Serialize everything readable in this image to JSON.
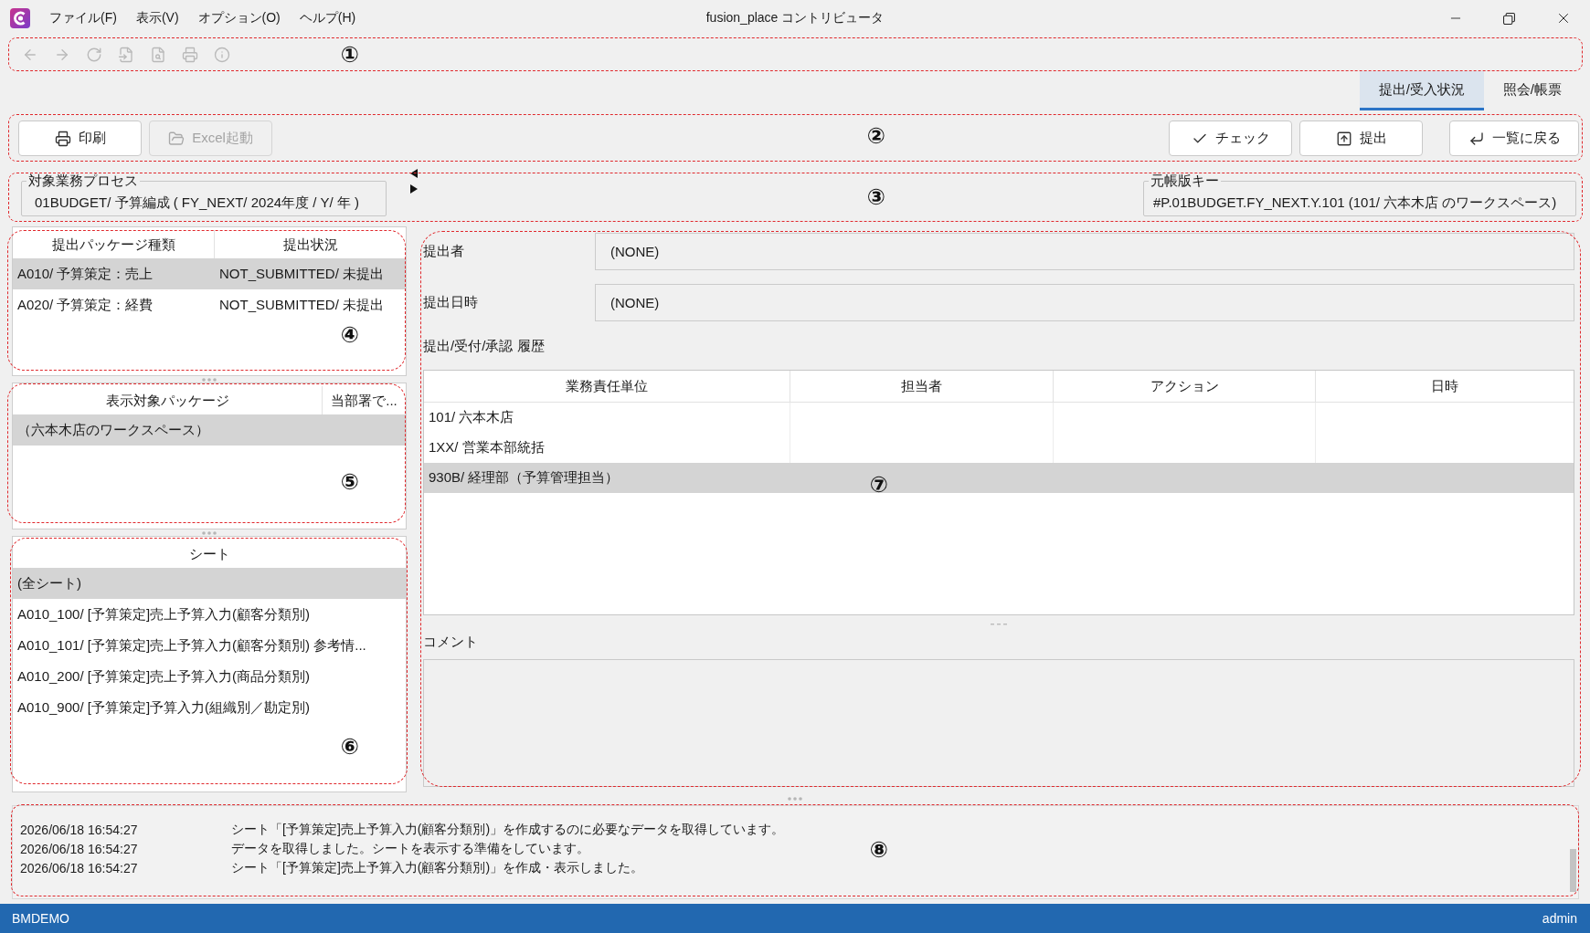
{
  "window": {
    "title": "fusion_place コントリビュータ",
    "menu": [
      "ファイル(F)",
      "表示(V)",
      "オプション(O)",
      "ヘルプ(H)"
    ]
  },
  "toolbar": {
    "callout": "①",
    "buttons": [
      {
        "disabled": true
      },
      {
        "disabled": true
      },
      {
        "disabled": true
      },
      {
        "disabled": true
      },
      {
        "disabled": true
      },
      {
        "disabled": true
      },
      {
        "disabled": true
      }
    ]
  },
  "tabs": [
    {
      "label": "提出/受入状況",
      "selected": true
    },
    {
      "label": "照会/帳票",
      "selected": false
    }
  ],
  "action_bar": {
    "callout": "②",
    "left_buttons": [
      {
        "label": "印刷",
        "disabled": false
      },
      {
        "label": "Excel起動",
        "disabled": true
      }
    ],
    "right_buttons": [
      {
        "label": "チェック",
        "disabled": false
      },
      {
        "label": "提出",
        "disabled": false
      }
    ],
    "back_button": {
      "label": "一覧に戻る",
      "disabled": false
    }
  },
  "context": {
    "callout": "③",
    "process": {
      "legend": "対象業務プロセス",
      "value": "01BUDGET/ 予算編成 ( FY_NEXT/ 2024年度 / Y/ 年 )"
    },
    "ledger_key": {
      "legend": "元帳版キー",
      "value": "#P.01BUDGET.FY_NEXT.Y.101 (101/ 六本木店 のワークスペース)"
    }
  },
  "package_table": {
    "callout": "④",
    "columns": [
      "提出パッケージ種類",
      "提出状況"
    ],
    "rows": [
      {
        "cells": [
          "A010/ 予算策定：売上",
          "NOT_SUBMITTED/ 未提出"
        ],
        "selected": true
      },
      {
        "cells": [
          "A020/ 予算策定：経費",
          "NOT_SUBMITTED/ 未提出"
        ],
        "selected": false
      }
    ]
  },
  "target_table": {
    "callout": "⑤",
    "columns": [
      "表示対象パッケージ",
      "当部署で..."
    ],
    "rows": [
      {
        "cells": [
          "（六本木店のワークスペース）"
        ],
        "selected": true
      }
    ]
  },
  "sheet_list": {
    "callout": "⑥",
    "column": "シート",
    "rows": [
      {
        "label": "(全シート)",
        "selected": true
      },
      {
        "label": "A010_100/ [予算策定]売上予算入力(顧客分類別)",
        "selected": false
      },
      {
        "label": "A010_101/ [予算策定]売上予算入力(顧客分類別) 参考情...",
        "selected": false
      },
      {
        "label": "A010_200/ [予算策定]売上予算入力(商品分類別)",
        "selected": false
      },
      {
        "label": "A010_900/ [予算策定]予算入力(組織別／勘定別)",
        "selected": false
      }
    ]
  },
  "detail": {
    "callout": "⑦",
    "submitter": {
      "label": "提出者",
      "value": "(NONE)"
    },
    "submitted_at": {
      "label": "提出日時",
      "value": "(NONE)"
    },
    "history": {
      "title": "提出/受付/承認 履歴",
      "columns": [
        "業務責任単位",
        "担当者",
        "アクション",
        "日時"
      ],
      "rows": [
        {
          "cells": [
            "101/ 六本木店"
          ],
          "selected": false
        },
        {
          "cells": [
            "1XX/ 営業本部統括"
          ],
          "selected": false
        },
        {
          "cells": [
            "930B/ 経理部（予算管理担当）"
          ],
          "selected": true
        }
      ]
    },
    "comment": {
      "label": "コメント"
    }
  },
  "log": {
    "callout": "⑧",
    "entries": [
      {
        "time": "2026/06/18 16:54:27",
        "message": "シート「[予算策定]売上予算入力(顧客分類別)」を作成するのに必要なデータを取得しています。"
      },
      {
        "time": "2026/06/18 16:54:27",
        "message": "データを取得しました。シートを表示する準備をしています。"
      },
      {
        "time": "2026/06/18 16:54:27",
        "message": "シート「[予算策定]売上予算入力(顧客分類別)」を作成・表示しました。"
      }
    ]
  },
  "status_bar": {
    "left": "BMDEMO",
    "right": "admin"
  }
}
